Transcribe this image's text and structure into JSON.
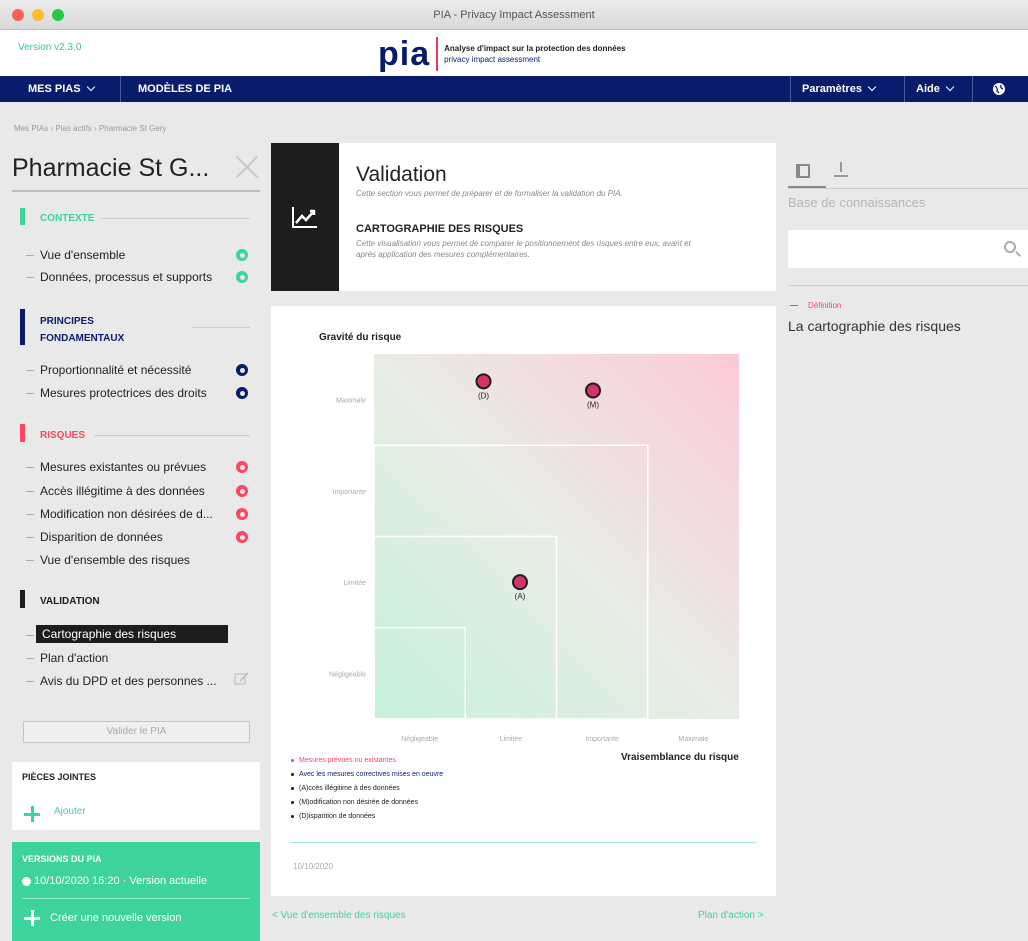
{
  "window": {
    "title": "PIA - Privacy Impact Assessment"
  },
  "header": {
    "version": "Version v2.3.0",
    "logo_text": "pia",
    "tagline_main": "Analyse d'impact sur la protection des données",
    "tagline_sub": "privacy impact assessment"
  },
  "nav": {
    "mes_pias": "MES PIAS",
    "modeles": "MODÈLES DE PIA",
    "parametres": "Paramètres",
    "aide": "Aide"
  },
  "breadcrumb": "Mes PIAs › Pias actifs › Pharmacie St Gery",
  "left": {
    "pia_title": "Pharmacie St G...",
    "sections": {
      "contexte": {
        "label": "CONTEXTE",
        "color": "#3ed39a",
        "items": [
          "Vue d'ensemble",
          "Données, processus et supports"
        ]
      },
      "principes": {
        "label_1": "PRINCIPES",
        "label_2": "FONDAMENTAUX",
        "color": "#091c6b",
        "items": [
          "Proportionnalité et nécessité",
          "Mesures protectrices des droits"
        ]
      },
      "risques": {
        "label": "RISQUES",
        "color": "#fd4664",
        "items": [
          "Mesures existantes ou prévues",
          "Accès illégitime à des données",
          "Modification non désirées de d...",
          "Disparition de données",
          "Vue d'ensemble des risques"
        ]
      },
      "validation": {
        "label": "VALIDATION",
        "color": "#1d1d1d",
        "items": [
          "Cartographie des risques",
          "Plan d'action",
          "Avis du DPD et des personnes ..."
        ]
      }
    },
    "validate_button": "Valider le PIA",
    "attachments": {
      "title": "PIÈCES JOINTES",
      "add": "Ajouter"
    },
    "versions": {
      "title": "VERSIONS DU PIA",
      "current": "10/10/2020 16:20 · Version actuelle",
      "create": "Créer une nouvelle version"
    }
  },
  "center": {
    "section_title": "Validation",
    "section_desc": "Cette section vous permet de préparer et de formaliser la validation du PIA.",
    "sub_title": "CARTOGRAPHIE DES RISQUES",
    "sub_desc": "Cette visualisation vous permet de comparer le positionnement des risques entre eux, avant et après application des mesures complémentaires.",
    "legend": [
      {
        "text": "Mesures prévues ou existantes",
        "color": "#fd4664"
      },
      {
        "text": "Avec les mesures correctives mises en oeuvre",
        "color": "#091c6b"
      },
      {
        "text": "(A)ccès illégitime à des données",
        "color": "#1d1d1d"
      },
      {
        "text": "(M)odification non désirée de données",
        "color": "#1d1d1d"
      },
      {
        "text": "(D)isparition de données",
        "color": "#1d1d1d"
      }
    ],
    "date": "10/10/2020",
    "prev_link": "< Vue d'ensemble des risques",
    "next_link": "Plan d'action >"
  },
  "chart_data": {
    "type": "scatter",
    "xlabel": "Vraisemblance du risque",
    "ylabel": "Gravité du risque",
    "x_categories": [
      "Négligeable",
      "Limitée",
      "Importante",
      "Maximale"
    ],
    "y_categories": [
      "Négligeable",
      "Limitée",
      "Importante",
      "Maximale"
    ],
    "points": [
      {
        "label": "(D)",
        "x": 1.2,
        "y": 3.7
      },
      {
        "label": "(M)",
        "x": 2.4,
        "y": 3.6
      },
      {
        "label": "(A)",
        "x": 1.6,
        "y": 1.5
      }
    ],
    "colors": {
      "point_fill": "#d6336c",
      "point_stroke": "#1d1d1d"
    }
  },
  "right": {
    "kb_title": "Base de connaissances",
    "def_tag": "Définition",
    "def_text": "La cartographie des risques"
  }
}
